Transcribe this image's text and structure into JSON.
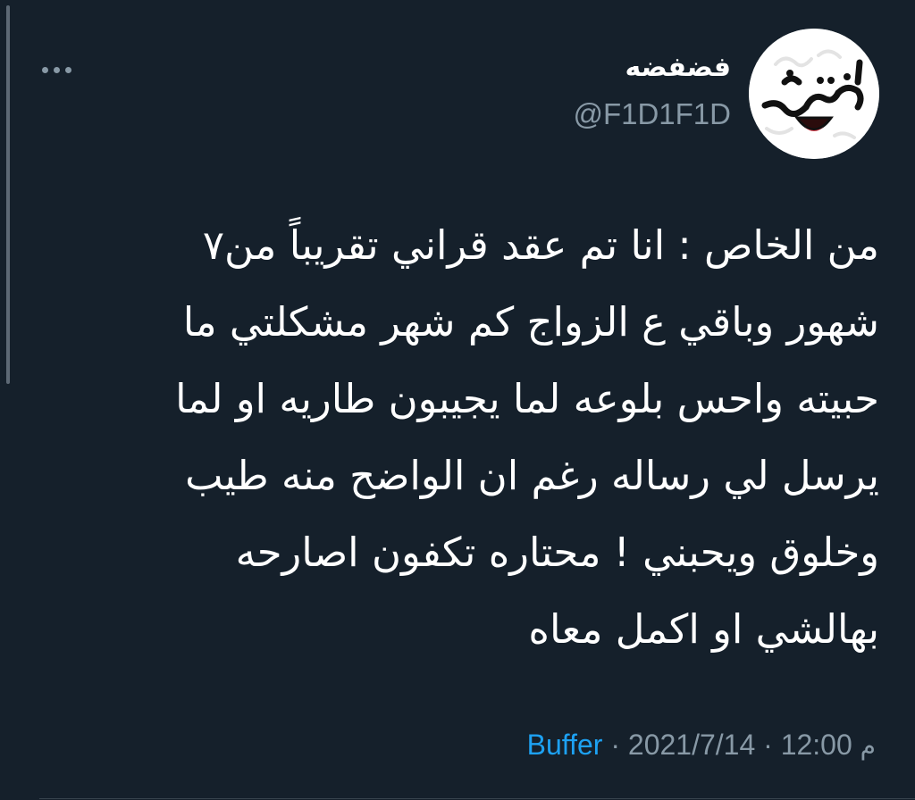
{
  "user": {
    "display_name": "فضفضه",
    "handle": "@F1D1F1D",
    "avatar_text": "فضفضة"
  },
  "tweet": {
    "lines": [
      "من الخاص : انا تم عقد قراني تقريباً من٧",
      "شهور وباقي ع الزواج كم شهر مشكلتي ما",
      "حبيته واحس بلوعه لما يجيبون طاريه او لما",
      "يرسل لي رساله رغم ان الواضح منه طيب",
      "وخلوق ويحبني ! محتاره تكفون اصارحه",
      "بهالشي او اكمل معاه"
    ]
  },
  "meta": {
    "date": "2021/7/14",
    "time": "12:00",
    "ampm": "م",
    "separator": "·",
    "source": "Buffer"
  },
  "icons": {
    "more": "more-horizontal-icon"
  },
  "colors": {
    "background": "#15202b",
    "text": "#ffffff",
    "secondary": "#8899a6",
    "link": "#1da1f2"
  }
}
